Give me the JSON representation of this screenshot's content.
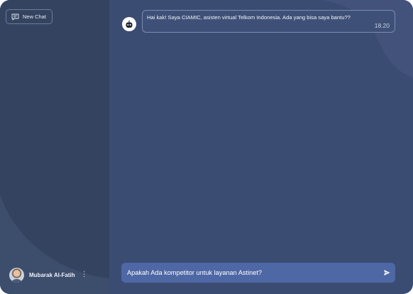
{
  "sidebar": {
    "new_chat_label": "New Chat",
    "user": {
      "name": "Mubarak Al-Fatih",
      "menu_glyph": "⋮"
    }
  },
  "chat": {
    "messages": [
      {
        "sender": "bot",
        "text": "Hai kak! Saya CIAMIC, asisten virtual Telkom Indonesia. Ada yang bisa saya bantu??",
        "time": "18.20"
      }
    ]
  },
  "composer": {
    "value": "Apakah Ada kompetitor untuk layanan Astinet?"
  },
  "icons": {
    "new_chat": "chat-bubble-icon",
    "bot": "robot-icon",
    "send": "send-icon",
    "menu": "kebab-menu-icon"
  },
  "colors": {
    "sidebar": "#34435f",
    "main": "#3b4c73",
    "input_bar": "#4e67a5",
    "bubble_border": "#7d8cab"
  }
}
